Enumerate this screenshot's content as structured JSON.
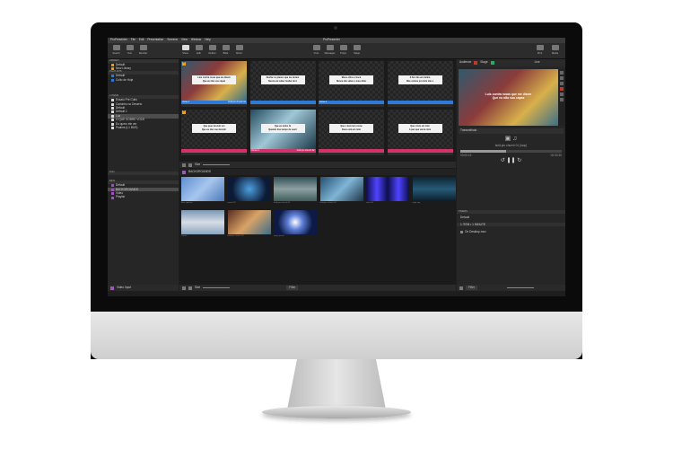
{
  "app": {
    "name": "ProPresenter",
    "window_title": "ProPresenter"
  },
  "menu": [
    "ProPresenter",
    "File",
    "Edit",
    "Presentation",
    "Screens",
    "View",
    "Window",
    "Help"
  ],
  "toolbar": {
    "left": [
      {
        "label": "Search",
        "icon": "search-icon"
      },
      {
        "label": "Text",
        "icon": "text-icon"
      },
      {
        "label": "Reorder",
        "icon": "reorder-icon"
      }
    ],
    "modes": [
      {
        "label": "Show",
        "icon": "show-icon",
        "active": true
      },
      {
        "label": "Edit",
        "icon": "edit-icon"
      },
      {
        "label": "Reflow",
        "icon": "reflow-icon"
      },
      {
        "label": "Bible",
        "icon": "bible-icon"
      },
      {
        "label": "Mirror",
        "icon": "mirror-icon"
      }
    ],
    "center": [
      {
        "label": "Vmix",
        "icon": "timer-icon"
      },
      {
        "label": "Messages",
        "icon": "messages-icon"
      },
      {
        "label": "Props",
        "icon": "props-icon"
      },
      {
        "label": "Stage",
        "icon": "stage-icon"
      }
    ],
    "right": [
      {
        "label": "Print",
        "icon": "print-icon"
      },
      {
        "label": "Media",
        "icon": "media-icon"
      }
    ]
  },
  "library": {
    "header": "LIBRARY",
    "items": [
      {
        "label": "Default",
        "color": "#e3a223"
      },
      {
        "label": "New Library",
        "color": "#e3a223"
      }
    ],
    "playlist_header": "PLAYLISTS",
    "playlists": [
      {
        "label": "Default",
        "color": "#2f7ad6"
      },
      {
        "label": "Culto de Hoje",
        "color": "#2f7ad6"
      }
    ]
  },
  "items": {
    "header": "4 ITEMS",
    "list": [
      "Ensaio Pré Culto",
      "Caminho no Deserto",
      "Default",
      "Default 1",
      "Luz",
      "O QUE SOBRE VOCE",
      "Eu quero ele ver",
      "Psalms (L1 BUS)"
    ],
    "selected_index": 4
  },
  "filter_label": "Filter",
  "media_bins": {
    "header": "BINS",
    "items": [
      "Default",
      "BACKGROUNDS",
      "Video",
      "Playlist"
    ],
    "selected_index": 1
  },
  "video_input_label": "Video Input",
  "slides": [
    {
      "num": "A",
      "line1": "Luis contra rosas que me dizem",
      "line2": "Que eu não sou capaz",
      "label": "Verse 1",
      "sub": "built-pro church 01",
      "color": "#2f7ad6",
      "bg": "photo1"
    },
    {
      "num": "",
      "line1": "Desfaz os planos que me deram",
      "line2": "Nunca vai saber mudar de ti",
      "label": "",
      "sub": "",
      "color": "#2f7ad6",
      "bg": "checker"
    },
    {
      "num": "",
      "line1": "Meus olhos e boca",
      "line2": "Nunca vão saber o meu olhar",
      "label": "Verse 2",
      "sub": "",
      "color": "#2f7ad6",
      "bg": "checker"
    },
    {
      "num": "",
      "line1": "E fico tão em minha",
      "line2": "Mas cantou pra mim não é",
      "label": "",
      "sub": "",
      "color": "#2f7ad6",
      "bg": "checker"
    },
    {
      "num": "B",
      "line1": "Que quer desistir em",
      "line2": "Que eu não vou desistir",
      "label": "",
      "sub": "",
      "color": "#d1346b",
      "bg": "checker"
    },
    {
      "num": "",
      "line1": "Que eu tenho fé",
      "line2": "Quando tive tempo de ouvir",
      "label": "Chorus 1",
      "sub": "built-pro church 02",
      "color": "#d1346b",
      "bg": "photo2"
    },
    {
      "num": "",
      "line1": "Que o bem tem nome",
      "line2": "Deus está em mim",
      "label": "",
      "sub": "",
      "color": "#d1346b",
      "bg": "checker"
    },
    {
      "num": "",
      "line1": "Que cristo em mim",
      "line2": "A paz que vai de mim",
      "label": "",
      "sub": "",
      "color": "#d1346b",
      "bg": "checker"
    }
  ],
  "size_label": "Size",
  "bin_title": "BACKGROUNDS",
  "media": [
    {
      "caption": "blue squares",
      "bg": "linear-gradient(135deg,#5e8fd1,#a7c6ee,#4b79b8)"
    },
    {
      "caption": "tunnel 02",
      "bg": "radial-gradient(circle,#4d9fe0,#0c1a35 70%)"
    },
    {
      "caption": "built-pro church 03",
      "bg": "linear-gradient(#2f4f58,#8ea0a0,#3d5e5c)"
    },
    {
      "caption": "built-pro church 04",
      "bg": "linear-gradient(135deg,#24506f,#7fb5d6,#1d3447)"
    },
    {
      "caption": "stars 05",
      "bg": "linear-gradient(90deg,#0d0f4d,#4f43ff,#0d0f4d,#4f43ff,#0d0f4d)"
    },
    {
      "caption": "night city",
      "bg": "linear-gradient(#0e2433,#275a78,#0c1d2a)"
    },
    {
      "caption": "clouds",
      "bg": "linear-gradient(#7b97b3,#d6dde6,#8aa5bf)"
    },
    {
      "caption": "built-pro church 05",
      "bg": "linear-gradient(135deg,#5b2d20,#d9a366,#3b6c8d)"
    },
    {
      "caption": "warp speed",
      "bg": "radial-gradient(circle,#ffffff,#5f7fd8 30%,#0c1a45 70%)"
    }
  ],
  "output": {
    "audience_label": "Audience",
    "stage_label": "Stage",
    "live": "Live",
    "preview_line1": "Luis contra rosas que me dizem",
    "preview_line2": "Que eu não sou capaz",
    "transport_label": "Transmitindo",
    "now_playing": "built-pro church 01 (loop)",
    "time_start": "00:00:15",
    "time_end": "00:00:30"
  },
  "timers": {
    "header": "TIMERS",
    "default": "Default",
    "timer": "1 ITEM • 1 MINUTE",
    "row": "On Desktop.mov"
  }
}
